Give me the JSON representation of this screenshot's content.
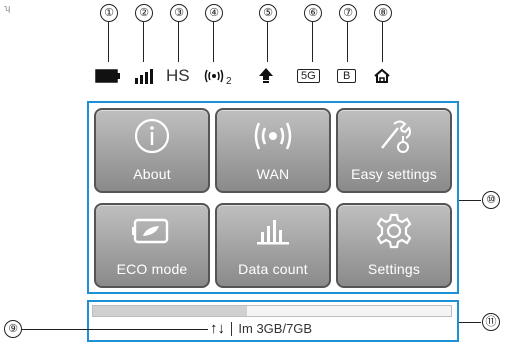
{
  "corner_mark": "ʮ",
  "callouts": [
    "①",
    "②",
    "③",
    "④",
    "⑤",
    "⑥",
    "⑦",
    "⑧",
    "⑨",
    "⑩",
    "⑪"
  ],
  "status": {
    "network_type": "HS",
    "wifi_sub": "2",
    "band_5g": "5G",
    "band_b": "B"
  },
  "menu": {
    "tiles": [
      {
        "label": "About",
        "icon": "info-icon"
      },
      {
        "label": "WAN",
        "icon": "wan-signal-icon"
      },
      {
        "label": "Easy settings",
        "icon": "tools-icon"
      },
      {
        "label": "ECO mode",
        "icon": "battery-eco-icon"
      },
      {
        "label": "Data count",
        "icon": "bar-chart-icon"
      },
      {
        "label": "Settings",
        "icon": "gear-icon"
      }
    ]
  },
  "usage": {
    "arrows": "↑↓",
    "text": "Im 3GB/7GB",
    "progress_fraction": 0.43
  },
  "colors": {
    "frame": "#1f8fd6",
    "tile": "#9a9a9a"
  }
}
